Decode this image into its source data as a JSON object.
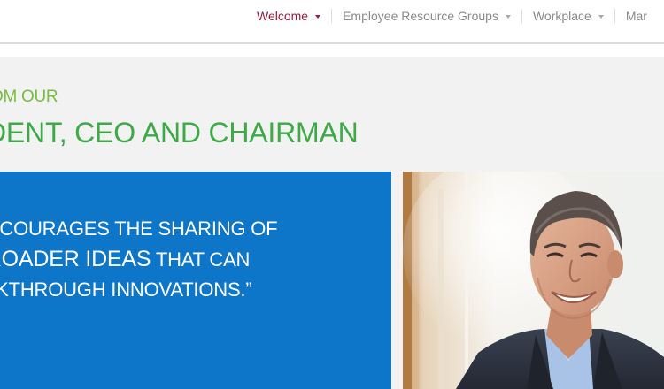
{
  "nav": {
    "items": [
      {
        "label": "Welcome",
        "active": true
      },
      {
        "label": "Employee Resource Groups",
        "active": false
      },
      {
        "label": "Workplace",
        "active": false
      },
      {
        "label": "Mar",
        "active": false
      }
    ]
  },
  "hero": {
    "eyebrow": "OM OUR",
    "heading": "DENT, CEO AND CHAIRMAN",
    "quote": {
      "line1": "TY ENCOURAGES THE SHARING OF",
      "line2_big": "R, BROADER IDEAS",
      "line2_rest": " THAT CAN",
      "line3": "BREAKTHROUGH INNOVATIONS.”"
    },
    "photo_icon": "portrait-photo"
  },
  "colors": {
    "nav_active": "#9b1b3b",
    "nav_text": "#8a8a8a",
    "band_bg": "#f2f2f2",
    "heading_green": "#3eaa47",
    "eyebrow_green": "#78be3e",
    "quote_blue": "#0e76c8"
  }
}
